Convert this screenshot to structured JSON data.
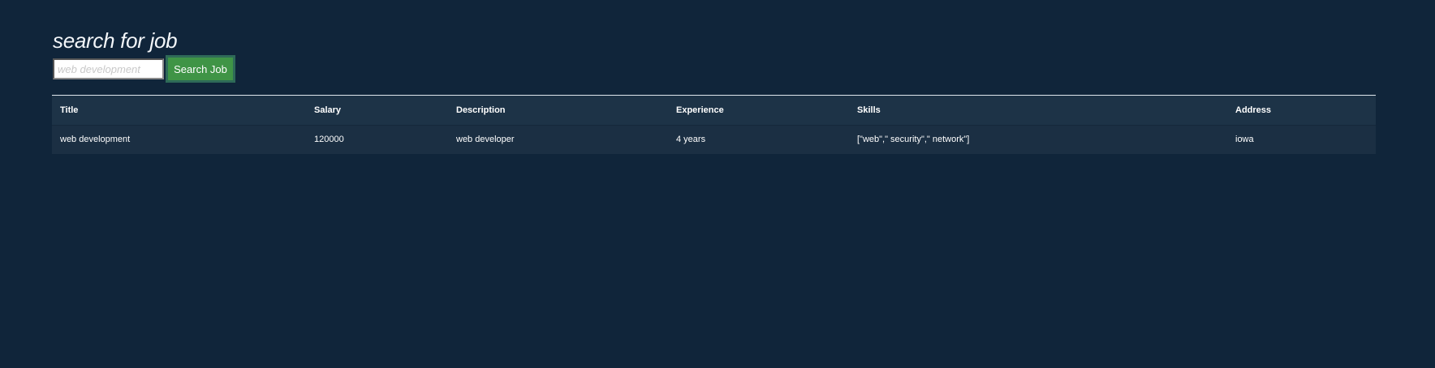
{
  "header": {
    "title": "search for job"
  },
  "search": {
    "placeholder": "web development",
    "value": "",
    "button_label": "Search Job"
  },
  "table": {
    "columns": [
      "Title",
      "Salary",
      "Description",
      "Experience",
      "Skills",
      "Address"
    ],
    "rows": [
      [
        "web development",
        "120000",
        "web developer",
        "4 years",
        "[\"web\",\" security\",\" network\"]",
        "iowa"
      ]
    ]
  },
  "colors": {
    "background": "#10253a",
    "table_header_bg": "#1d3347",
    "table_row_bg": "#1b2f43",
    "button_bg": "#3f9446",
    "button_border": "#2e6a58"
  }
}
